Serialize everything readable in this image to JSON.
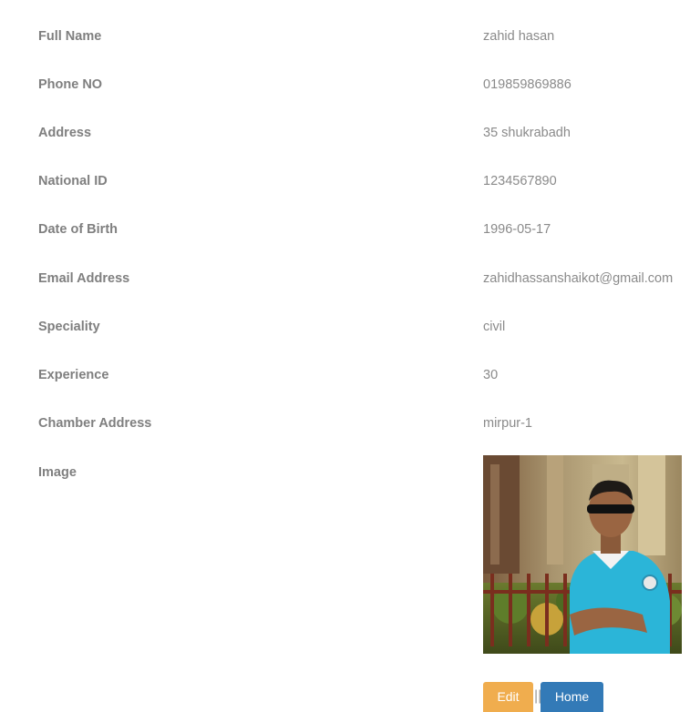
{
  "profile": {
    "rows": [
      {
        "label": "Full Name",
        "value": "zahid hasan"
      },
      {
        "label": "Phone NO",
        "value": "019859869886"
      },
      {
        "label": "Address",
        "value": "35 shukrabadh"
      },
      {
        "label": "National ID",
        "value": "1234567890"
      },
      {
        "label": "Date of Birth",
        "value": "1996-05-17"
      },
      {
        "label": "Email Address",
        "value": "zahidhassanshaikot@gmail.com"
      },
      {
        "label": "Speciality",
        "value": "civil"
      },
      {
        "label": "Experience",
        "value": "30"
      },
      {
        "label": "Chamber Address",
        "value": "mirpur-1"
      }
    ],
    "image_label": "Image"
  },
  "actions": {
    "edit_label": "Edit",
    "separator": "||",
    "home_label": "Home"
  },
  "colors": {
    "edit_button": "#f0ad4e",
    "home_button": "#337ab7",
    "text": "#7f7f7f"
  }
}
